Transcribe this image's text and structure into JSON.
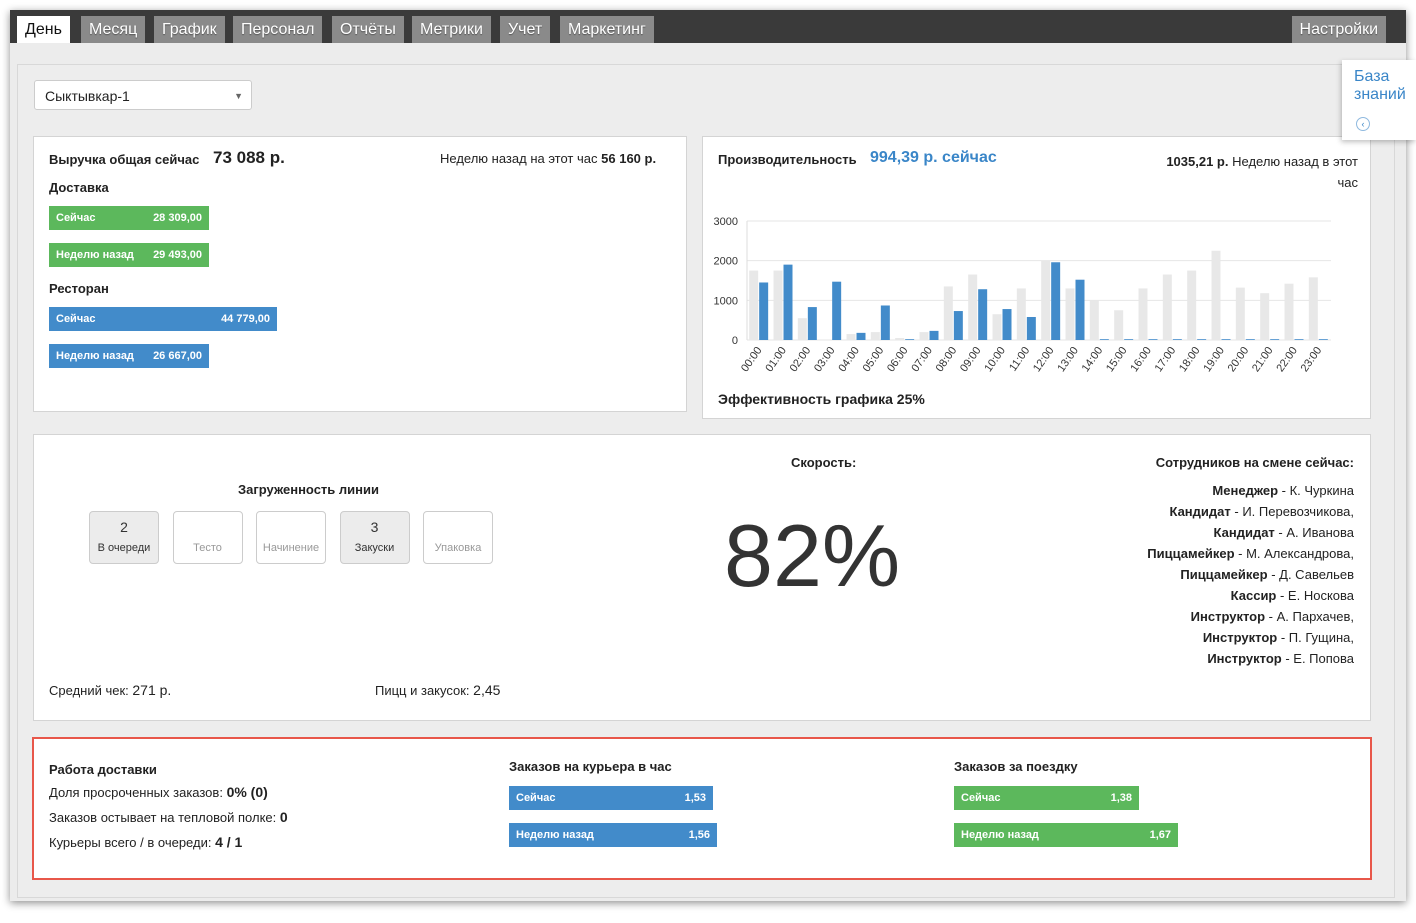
{
  "nav": {
    "tabs": [
      "День",
      "Месяц",
      "График",
      "Персонал",
      "Отчёты",
      "Метрики",
      "Учет",
      "Маркетинг"
    ],
    "active_tab": "День",
    "settings_label": "Настройки"
  },
  "knowledge_base": {
    "label": "База знаний"
  },
  "store_select": {
    "value": "Сыктывкар-1"
  },
  "revenue": {
    "title": "Выручка общая сейчас",
    "total": "73 088 р.",
    "week_ago_label": "Неделю назад на этот час",
    "week_ago_value": "56 160 р.",
    "delivery_label": "Доставка",
    "restaurant_label": "Ресторан",
    "bars": [
      {
        "label": "Сейчас",
        "value": "28 309,00",
        "amount": 28309,
        "color": "#5cb85c"
      },
      {
        "label": "Неделю назад",
        "value": "29 493,00",
        "amount": 29493,
        "color": "#5cb85c"
      },
      {
        "label": "Сейчас",
        "value": "44 779,00",
        "amount": 44779,
        "color": "#428bca"
      },
      {
        "label": "Неделю назад",
        "value": "26 667,00",
        "amount": 26667,
        "color": "#428bca"
      }
    ]
  },
  "productivity": {
    "title": "Производительность",
    "value": "994,39 р. сейчас",
    "week_ago_value": "1035,21 р.",
    "week_ago_label": "Неделю назад в этот",
    "week_ago_label2": "час",
    "efficiency": "Эффективность графика 25%"
  },
  "chart_data": {
    "type": "bar",
    "categories": [
      "00:00",
      "01:00",
      "02:00",
      "03:00",
      "04:00",
      "05:00",
      "06:00",
      "07:00",
      "08:00",
      "09:00",
      "10:00",
      "11:00",
      "12:00",
      "13:00",
      "14:00",
      "15:00",
      "16:00",
      "17:00",
      "18:00",
      "19:00",
      "20:00",
      "21:00",
      "22:00",
      "23:00"
    ],
    "series": [
      {
        "values": [
          1750,
          1750,
          550,
          0,
          150,
          200,
          50,
          200,
          1350,
          1650,
          650,
          1300,
          2000,
          1300,
          1000,
          750,
          1300,
          1650,
          1750,
          2250,
          1320,
          1180,
          1420,
          1580
        ],
        "color": "#e8e8e8"
      },
      {
        "values": [
          1450,
          1900,
          830,
          1470,
          180,
          870,
          20,
          230,
          730,
          1280,
          780,
          580,
          1960,
          1520,
          20,
          20,
          20,
          20,
          20,
          20,
          20,
          20,
          20,
          20
        ],
        "color": "#428bca"
      }
    ],
    "yticks": [
      "0",
      "1000",
      "2000",
      "3000"
    ],
    "ylim": [
      0,
      3000
    ],
    "grid": true
  },
  "line": {
    "title": "Загруженность линии",
    "stations": [
      {
        "count": "2",
        "label": "В очереди",
        "filled": true
      },
      {
        "count": "",
        "label": "Тесто",
        "filled": false
      },
      {
        "count": "",
        "label": "Начинение",
        "filled": false
      },
      {
        "count": "3",
        "label": "Закуски",
        "filled": true
      },
      {
        "count": "",
        "label": "Упаковка",
        "filled": false
      }
    ],
    "avg_check_label": "Средний чек:",
    "avg_check_value": "271 р.",
    "pizzas_label": "Пицц и закусок:",
    "pizzas_value": "2,45"
  },
  "speed": {
    "title": "Скорость:",
    "value": "82%"
  },
  "staff": {
    "title": "Сотрудников на смене сейчас:",
    "members": [
      {
        "role": "Менеджер",
        "name": " - К. Чуркина"
      },
      {
        "role": "Кандидат",
        "name": " - И. Перевозчикова,"
      },
      {
        "role": "Кандидат",
        "name": " - А. Иванова"
      },
      {
        "role": "Пиццамейкер",
        "name": " - М. Александрова,"
      },
      {
        "role": "Пиццамейкер",
        "name": " - Д. Савельев"
      },
      {
        "role": "Кассир",
        "name": " - Е. Носкова"
      },
      {
        "role": "Инструктор",
        "name": " - А. Пархачев,"
      },
      {
        "role": "Инструктор",
        "name": " - П. Гущина,"
      },
      {
        "role": "Инструктор",
        "name": " - Е. Попова"
      }
    ]
  },
  "delivery": {
    "title": "Работа доставки",
    "overdue_label": "Доля просроченных заказов:",
    "overdue_value": "0% (0)",
    "cooling_label": "Заказов остывает на тепловой полке:",
    "cooling_value": "0",
    "couriers_label": "Курьеры всего / в очереди:",
    "couriers_value": "4 / 1",
    "per_courier_title": "Заказов на курьера в час",
    "per_courier": [
      {
        "label": "Сейчас",
        "value": "1,53",
        "amount": 1.53
      },
      {
        "label": "Неделю назад",
        "value": "1,56",
        "amount": 1.56
      }
    ],
    "per_trip_title": "Заказов за поездку",
    "per_trip": [
      {
        "label": "Сейчас",
        "value": "1,38",
        "amount": 1.38
      },
      {
        "label": "Неделю назад",
        "value": "1,67",
        "amount": 1.67
      }
    ]
  }
}
